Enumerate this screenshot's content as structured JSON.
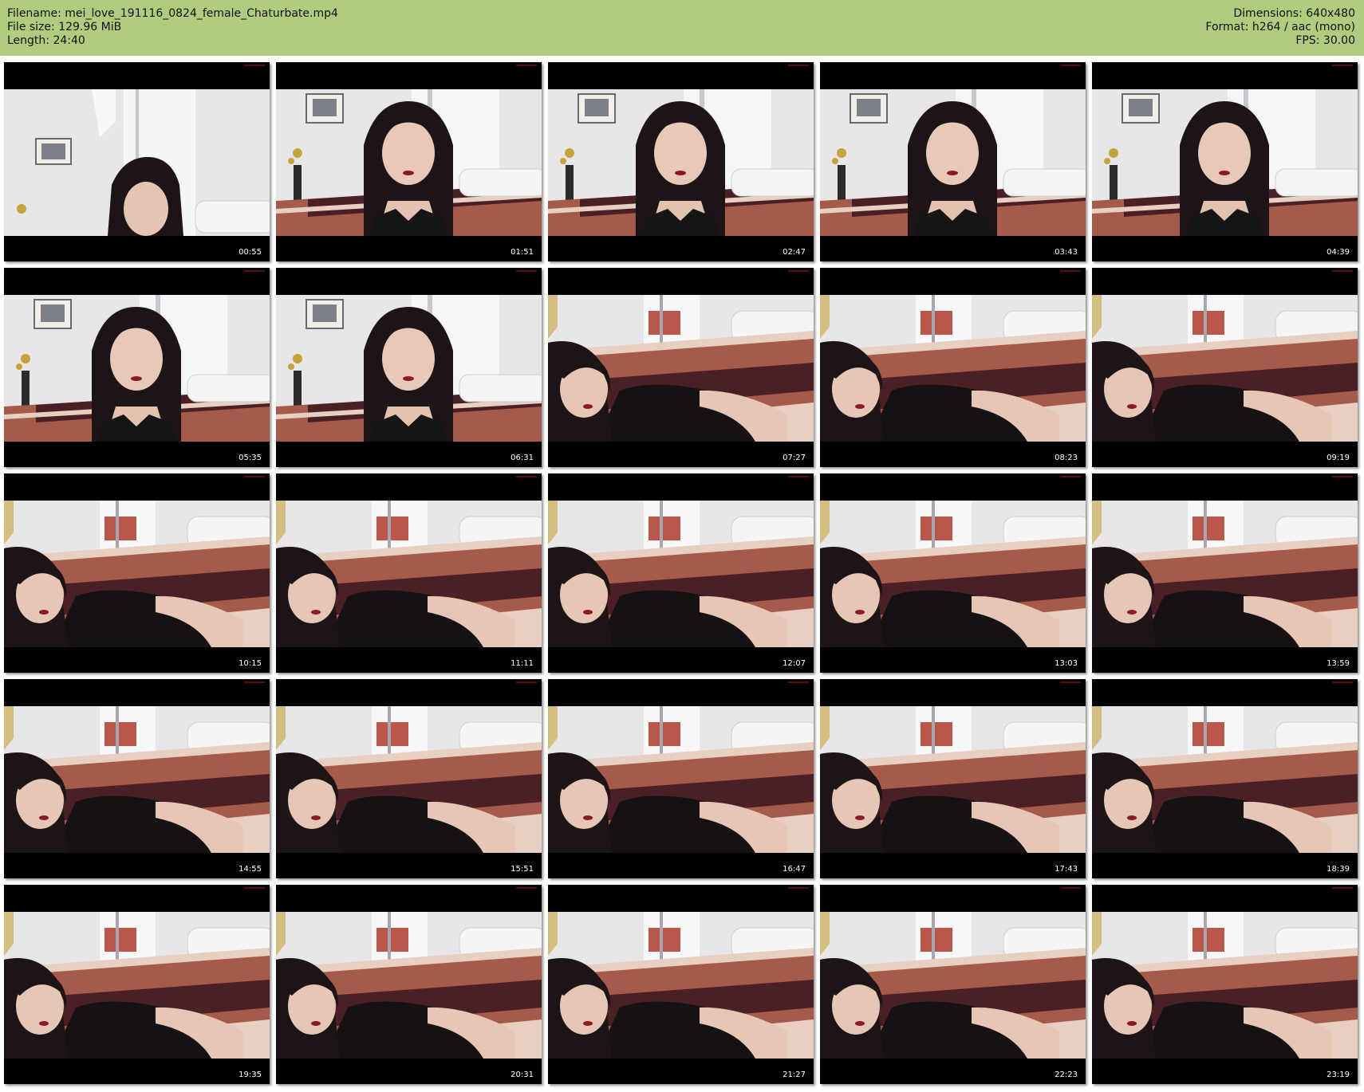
{
  "header": {
    "filename": "Filename: mei_love_191116_0824_female_Chaturbate.mp4",
    "filesize": "File size: 129.96 MiB",
    "length": "Length: 24:40",
    "dimensions": "Dimensions: 640x480",
    "format": "Format: h264 / aac (mono)",
    "fps": "FPS: 30.00"
  },
  "colors": {
    "header_bg": "#b1cc7e",
    "thumb_bg": "#000000",
    "wall": "#e9e6ea",
    "bedspread_dark": "#4a1f26",
    "bedspread_mid": "#a55a4a",
    "bedspread_light": "#e7cfc2"
  },
  "thumbnails": [
    {
      "time": "00:55",
      "scene": "close-wide"
    },
    {
      "time": "01:51",
      "scene": "sitting"
    },
    {
      "time": "02:47",
      "scene": "sitting"
    },
    {
      "time": "03:43",
      "scene": "sitting"
    },
    {
      "time": "04:39",
      "scene": "sitting"
    },
    {
      "time": "05:35",
      "scene": "sitting"
    },
    {
      "time": "06:31",
      "scene": "sitting"
    },
    {
      "time": "07:27",
      "scene": "lying"
    },
    {
      "time": "08:23",
      "scene": "lying"
    },
    {
      "time": "09:19",
      "scene": "lying"
    },
    {
      "time": "10:15",
      "scene": "lying"
    },
    {
      "time": "11:11",
      "scene": "lying"
    },
    {
      "time": "12:07",
      "scene": "lying"
    },
    {
      "time": "13:03",
      "scene": "lying"
    },
    {
      "time": "13:59",
      "scene": "lying"
    },
    {
      "time": "14:55",
      "scene": "lying"
    },
    {
      "time": "15:51",
      "scene": "lying"
    },
    {
      "time": "16:47",
      "scene": "lying"
    },
    {
      "time": "17:43",
      "scene": "lying"
    },
    {
      "time": "18:39",
      "scene": "lying"
    },
    {
      "time": "19:35",
      "scene": "lying"
    },
    {
      "time": "20:31",
      "scene": "lying"
    },
    {
      "time": "21:27",
      "scene": "lying"
    },
    {
      "time": "22:23",
      "scene": "lying"
    },
    {
      "time": "23:19",
      "scene": "lying"
    }
  ]
}
